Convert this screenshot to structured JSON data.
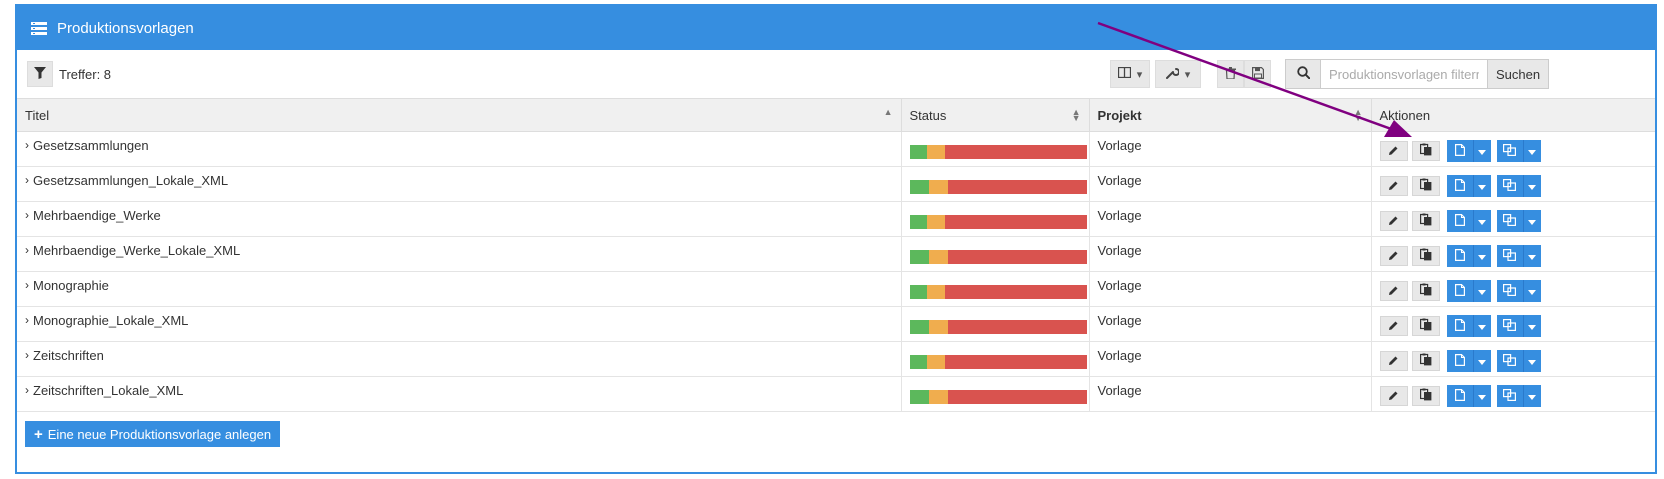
{
  "panel": {
    "title": "Produktionsvorlagen"
  },
  "toolbar": {
    "hits_label": "Treffer: 8",
    "search_placeholder": "Produktionsvorlagen filtern",
    "search_button": "Suchen"
  },
  "table": {
    "headers": {
      "title": "Titel",
      "status": "Status",
      "project": "Projekt",
      "actions": "Aktionen"
    },
    "rows": [
      {
        "title": "Gesetzsammlungen",
        "project": "Vorlage",
        "status": {
          "green": 0.1,
          "orange": 0.1,
          "red": 0.8
        }
      },
      {
        "title": "Gesetzsammlungen_Lokale_XML",
        "project": "Vorlage",
        "status": {
          "green": 0.11,
          "orange": 0.11,
          "red": 0.78
        }
      },
      {
        "title": "Mehrbaendige_Werke",
        "project": "Vorlage",
        "status": {
          "green": 0.1,
          "orange": 0.1,
          "red": 0.8
        }
      },
      {
        "title": "Mehrbaendige_Werke_Lokale_XML",
        "project": "Vorlage",
        "status": {
          "green": 0.11,
          "orange": 0.11,
          "red": 0.78
        }
      },
      {
        "title": "Monographie",
        "project": "Vorlage",
        "status": {
          "green": 0.1,
          "orange": 0.1,
          "red": 0.8
        }
      },
      {
        "title": "Monographie_Lokale_XML",
        "project": "Vorlage",
        "status": {
          "green": 0.11,
          "orange": 0.11,
          "red": 0.78
        }
      },
      {
        "title": "Zeitschriften",
        "project": "Vorlage",
        "status": {
          "green": 0.1,
          "orange": 0.1,
          "red": 0.8
        }
      },
      {
        "title": "Zeitschriften_Lokale_XML",
        "project": "Vorlage",
        "status": {
          "green": 0.11,
          "orange": 0.11,
          "red": 0.78
        }
      }
    ]
  },
  "footer": {
    "add_button": "Eine neue Produktionsvorlage anlegen"
  },
  "colors": {
    "accent": "#368ee0",
    "status_green": "#5cb85c",
    "status_orange": "#f0ad4e",
    "status_red": "#d9534f",
    "annotation_arrow": "#800080"
  },
  "icons": {
    "header": "list-icon",
    "filter": "filter-icon",
    "columns": "columns-icon",
    "tools": "wrench-icon",
    "delete": "trash-icon",
    "save": "save-icon",
    "search": "search-icon",
    "edit": "pencil-icon",
    "copy": "clipboard-copy-icon",
    "document": "file-icon",
    "duplicate": "copy-icon"
  }
}
